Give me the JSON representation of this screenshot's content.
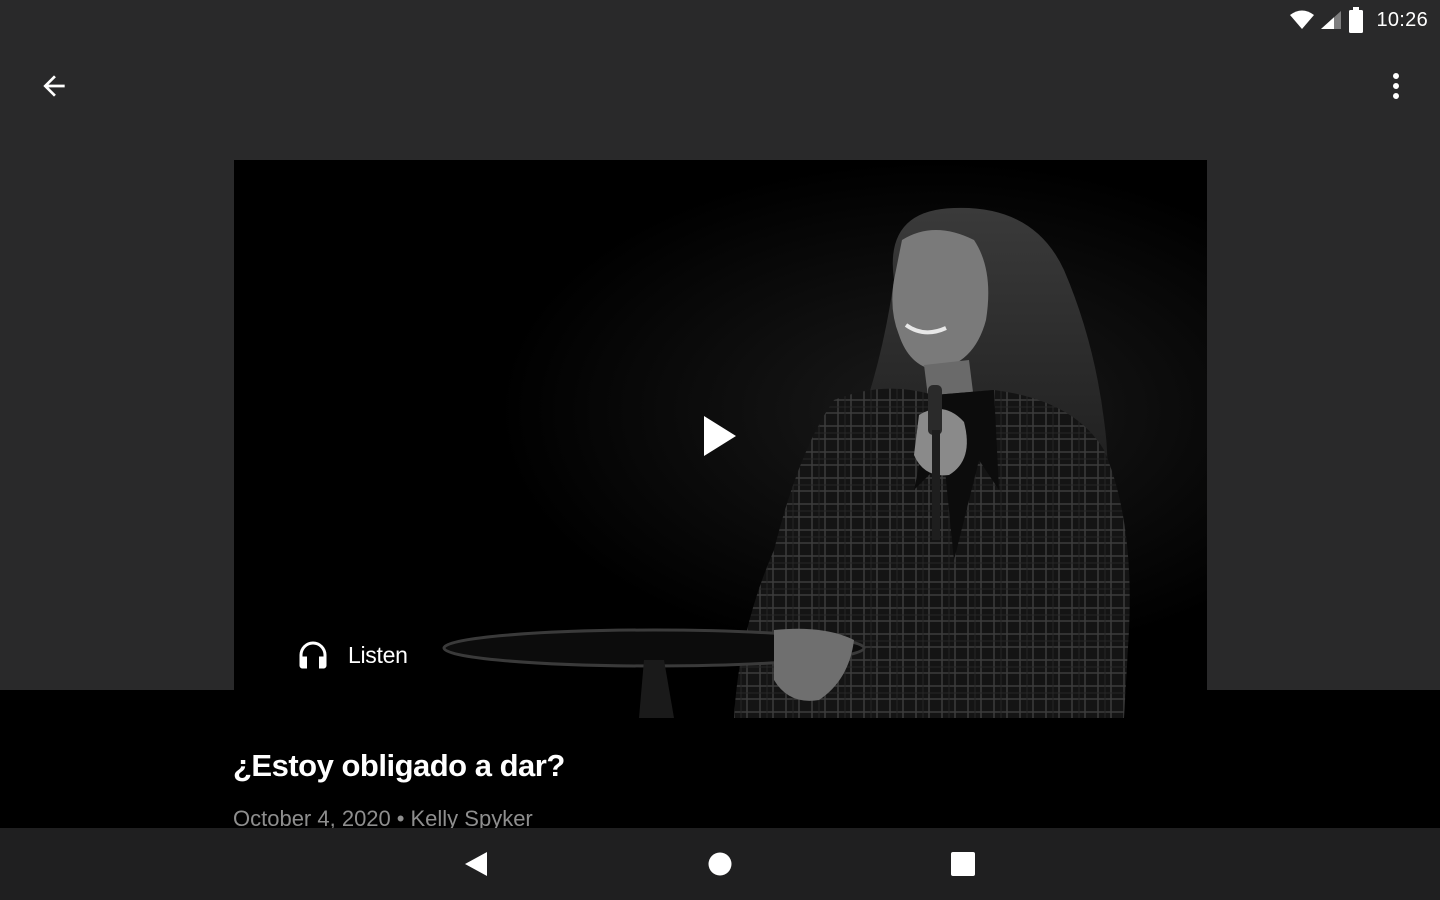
{
  "status_bar": {
    "time": "10:26",
    "icons": [
      "wifi-icon",
      "cell-signal-icon",
      "battery-icon"
    ]
  },
  "toolbar": {
    "back_icon": "arrow-back-icon",
    "overflow_icon": "more-vert-icon"
  },
  "video": {
    "play_icon": "play-icon",
    "listen_icon": "headphones-icon",
    "listen_label": "Listen"
  },
  "message": {
    "title": "¿Estoy obligado a dar?",
    "date": "October 4, 2020",
    "separator": "•",
    "speaker": "Kelly Spyker"
  },
  "nav_bar": {
    "back_icon": "nav-back-icon",
    "home_icon": "nav-home-icon",
    "recents_icon": "nav-recents-icon"
  },
  "colors": {
    "background": "#29292a",
    "video_background": "#000000",
    "meta_text": "#8e8e8e",
    "nav_bar": "#1f1f20"
  }
}
